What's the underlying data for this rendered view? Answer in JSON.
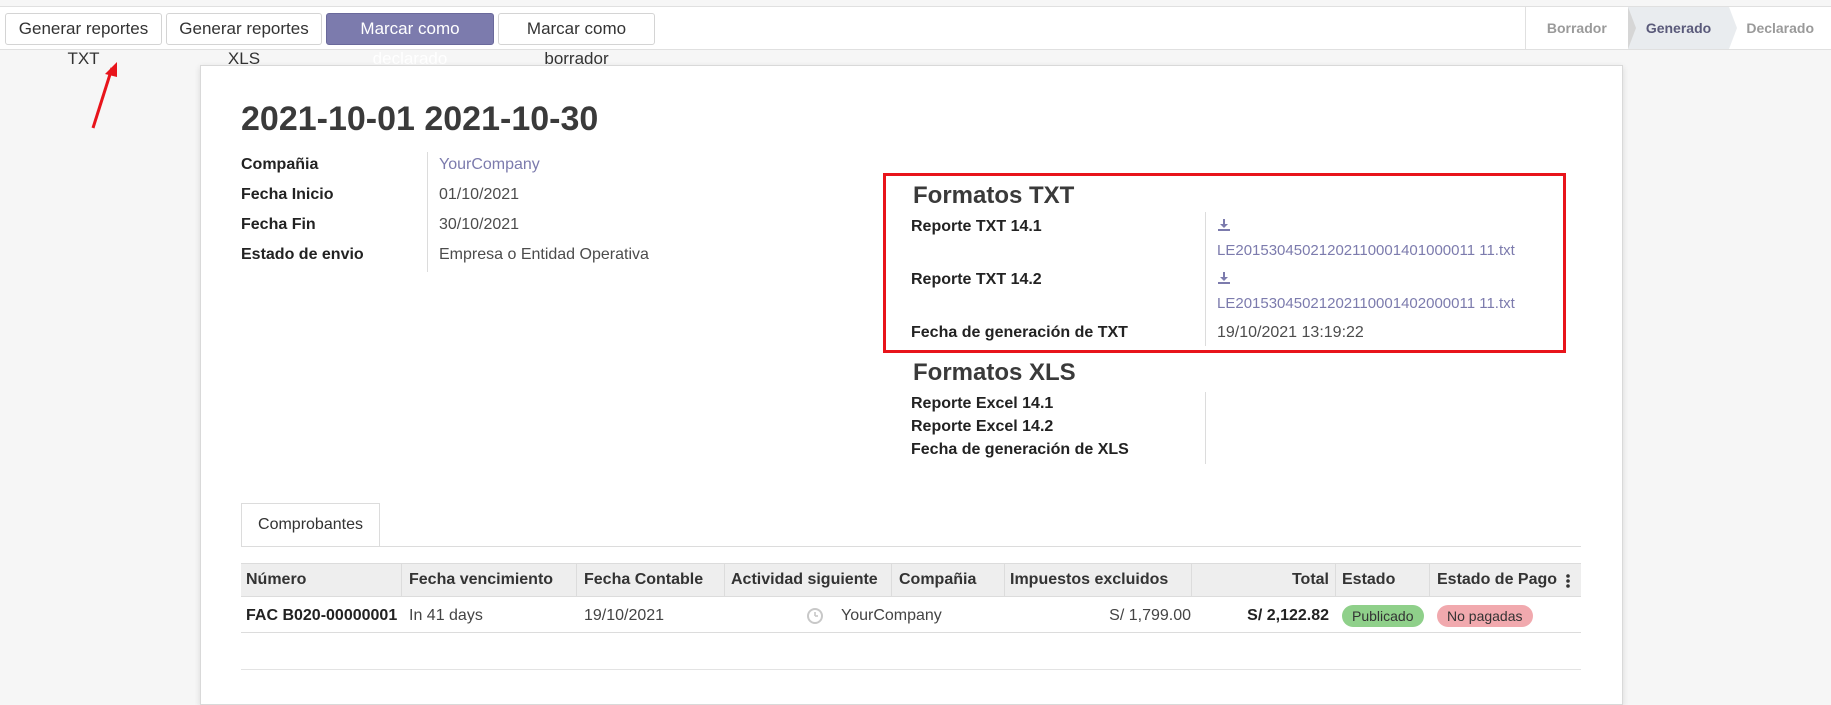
{
  "toolbar": {
    "btn_txt": "Generar reportes TXT",
    "btn_xls": "Generar reportes XLS",
    "btn_declarado": "Marcar como declarado",
    "btn_borrador": "Marcar como borrador"
  },
  "status": {
    "steps": [
      "Borrador",
      "Generado",
      "Declarado"
    ],
    "active": "Generado"
  },
  "record": {
    "title": "2021-10-01 2021-10-30",
    "fields": {
      "company_label": "Compañia",
      "company_value": "YourCompany",
      "start_label": "Fecha Inicio",
      "start_value": "01/10/2021",
      "end_label": "Fecha Fin",
      "end_value": "30/10/2021",
      "send_label": "Estado de envio",
      "send_value": "Empresa o Entidad Operativa"
    },
    "txt": {
      "title": "Formatos TXT",
      "r141_label": "Reporte TXT 14.1",
      "r141_file": "LE20153045021202110001401000011 11.txt",
      "r142_label": "Reporte TXT 14.2",
      "r142_file": "LE20153045021202110001402000011 11.txt",
      "date_label": "Fecha de generación de TXT",
      "date_value": "19/10/2021 13:19:22"
    },
    "xls": {
      "title": "Formatos XLS",
      "r141_label": "Reporte Excel 14.1",
      "r142_label": "Reporte Excel 14.2",
      "date_label": "Fecha de generación de XLS"
    }
  },
  "tabs": {
    "comprobantes": "Comprobantes"
  },
  "table": {
    "headers": {
      "numero": "Número",
      "vencimiento": "Fecha vencimiento",
      "contable": "Fecha Contable",
      "actividad": "Actividad siguiente",
      "compania": "Compañia",
      "impuestos": "Impuestos excluidos",
      "total": "Total",
      "estado": "Estado",
      "pago": "Estado de Pago"
    },
    "row": {
      "numero": "FAC B020-00000001",
      "vencimiento": "In 41 days",
      "contable": "19/10/2021",
      "compania": "YourCompany",
      "impuestos": "S/ 1,799.00",
      "total": "S/ 2,122.82",
      "estado": "Publicado",
      "pago": "No pagadas"
    }
  },
  "colors": {
    "primary": "#7c7bad",
    "annotation_red": "#e8141b",
    "badge_published": "#8fd08a",
    "badge_unpaid": "#f1a9ae"
  }
}
